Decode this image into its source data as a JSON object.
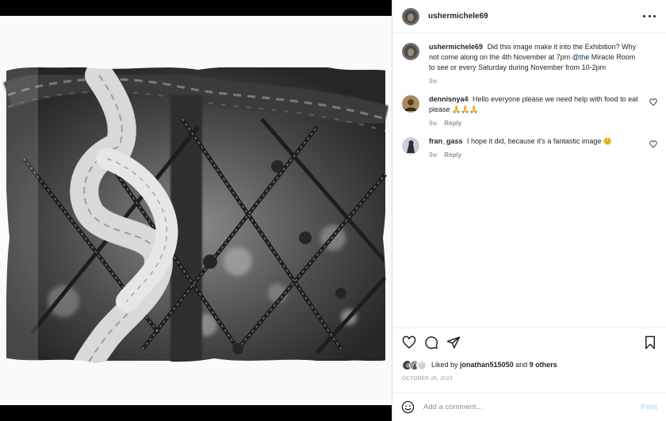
{
  "post": {
    "author": "ushermichele69",
    "avatar_icon": "author-avatar",
    "photo_description_icon": "rope-net-photo",
    "caption": {
      "username": "ushermichele69",
      "text_before": "Did this image make it into the Exhibition? Why not come along on the 4th November at 7pm",
      "mention": "@the",
      "text_after": "Miracle Room to see or every Saturday during November from 10-2pm",
      "time": "9w"
    },
    "comments": [
      {
        "username": "dennisnya4",
        "text": "Hello everyone please we need help with food to eat please 🙏🙏🙏",
        "time": "9w",
        "reply_label": "Reply"
      },
      {
        "username": "fran_gass",
        "text": "I hope it did, because it's a fantastic image 😊",
        "time": "9w",
        "reply_label": "Reply"
      }
    ],
    "likes": {
      "prefix": "Liked by",
      "user": "jonathan515050",
      "joiner": "and",
      "others": "9 others"
    },
    "date": "OCTOBER 25, 2022",
    "add_comment": {
      "placeholder": "Add a comment...",
      "post_label": "Post"
    }
  },
  "colors": {
    "link": "#00376b",
    "muted": "#8e8e8e",
    "post_disabled": "#b2dffc"
  }
}
